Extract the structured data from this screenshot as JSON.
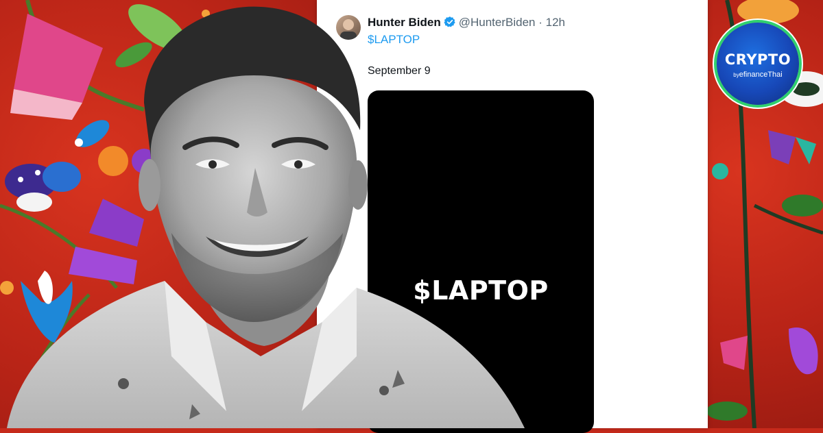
{
  "tweet": {
    "author_name": "Hunter Biden",
    "handle": "@HunterBiden",
    "separator": "·",
    "time_ago": "12h",
    "cashtag": "$LAPTOP",
    "date_text": "September 9",
    "media_text": "$LAPTOP",
    "verified_icon": "verified-badge-icon"
  },
  "watermark": {
    "main": "CRYPTO",
    "by": "by",
    "sub": "efinanceThai"
  },
  "colors": {
    "link_blue": "#1d9bf0",
    "background_red": "#c62a1b",
    "logo_blue": "#1748b8",
    "logo_ring_green": "#2fd06e"
  }
}
